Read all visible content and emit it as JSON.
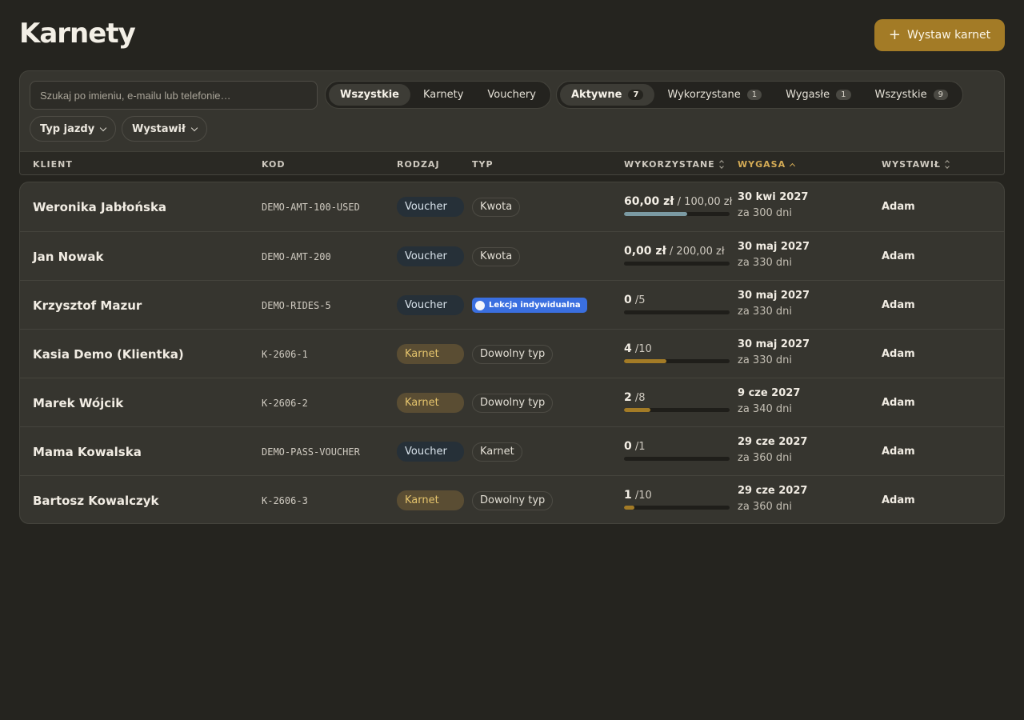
{
  "page": {
    "title": "Karnety"
  },
  "header": {
    "primary_action": {
      "icon": "plus-icon",
      "label": "Wystaw karnet"
    }
  },
  "filters": {
    "search_placeholder": "Szukaj po imieniu, e-mailu lub telefonie…",
    "kind_tabs": [
      {
        "label": "Wszystkie",
        "active": true
      },
      {
        "label": "Karnety",
        "active": false
      },
      {
        "label": "Vouchery",
        "active": false
      }
    ],
    "status_tabs": [
      {
        "label": "Aktywne",
        "count": "7",
        "active": true
      },
      {
        "label": "Wykorzystane",
        "count": "1",
        "active": false
      },
      {
        "label": "Wygasłe",
        "count": "1",
        "active": false
      },
      {
        "label": "Wszystkie",
        "count": "9",
        "active": false
      }
    ],
    "dropdowns": [
      {
        "label": "Typ jazdy"
      },
      {
        "label": "Wystawił"
      }
    ]
  },
  "table": {
    "columns": {
      "client": "KLIENT",
      "code": "KOD",
      "kind": "RODZAJ",
      "type": "TYP",
      "usage": "WYKORZYSTANE",
      "expires": "WYGASA",
      "issuer": "WYSTAWIŁ"
    },
    "sorted_column": "expires",
    "sort_direction": "ascending",
    "rows": [
      {
        "client": "Weronika Jabłońska",
        "code": "DEMO-AMT-100-USED",
        "kind": "Voucher",
        "type": "Kwota",
        "type_style": "plain",
        "used": "60,00 zł",
        "total": "/ 100,00 zł",
        "fraction": 0.6,
        "bar_color": "#7b9aa3",
        "expires": "30 kwi 2027",
        "expires_in": "za 300 dni",
        "issuer": "Adam"
      },
      {
        "client": "Jan Nowak",
        "code": "DEMO-AMT-200",
        "kind": "Voucher",
        "type": "Kwota",
        "type_style": "plain",
        "used": "0,00 zł",
        "total": "/ 200,00 zł",
        "fraction": 0,
        "bar_color": "#7b9aa3",
        "expires": "30 maj 2027",
        "expires_in": "za 330 dni",
        "issuer": "Adam"
      },
      {
        "client": "Krzysztof Mazur",
        "code": "DEMO-RIDES-5",
        "kind": "Voucher",
        "type": "Lekcja indywidualna",
        "type_style": "blue",
        "used": "0",
        "total": "/5",
        "fraction": 0,
        "bar_color": "#a37b26",
        "expires": "30 maj 2027",
        "expires_in": "za 330 dni",
        "issuer": "Adam"
      },
      {
        "client": "Kasia Demo (Klientka)",
        "code": "K-2606-1",
        "kind": "Karnet",
        "type": "Dowolny typ",
        "type_style": "plain",
        "used": "4",
        "total": "/10",
        "fraction": 0.4,
        "bar_color": "#a37b26",
        "expires": "30 maj 2027",
        "expires_in": "za 330 dni",
        "issuer": "Adam"
      },
      {
        "client": "Marek Wójcik",
        "code": "K-2606-2",
        "kind": "Karnet",
        "type": "Dowolny typ",
        "type_style": "plain",
        "used": "2",
        "total": "/8",
        "fraction": 0.25,
        "bar_color": "#a37b26",
        "expires": "9 cze 2027",
        "expires_in": "za 340 dni",
        "issuer": "Adam"
      },
      {
        "client": "Mama Kowalska",
        "code": "DEMO-PASS-VOUCHER",
        "kind": "Voucher",
        "type": "Karnet",
        "type_style": "plain",
        "used": "0",
        "total": "/1",
        "fraction": 0,
        "bar_color": "#a37b26",
        "expires": "29 cze 2027",
        "expires_in": "za 360 dni",
        "issuer": "Adam"
      },
      {
        "client": "Bartosz Kowalczyk",
        "code": "K-2606-3",
        "kind": "Karnet",
        "type": "Dowolny typ",
        "type_style": "plain",
        "used": "1",
        "total": "/10",
        "fraction": 0.1,
        "bar_color": "#a37b26",
        "expires": "29 cze 2027",
        "expires_in": "za 360 dni",
        "issuer": "Adam"
      }
    ]
  }
}
